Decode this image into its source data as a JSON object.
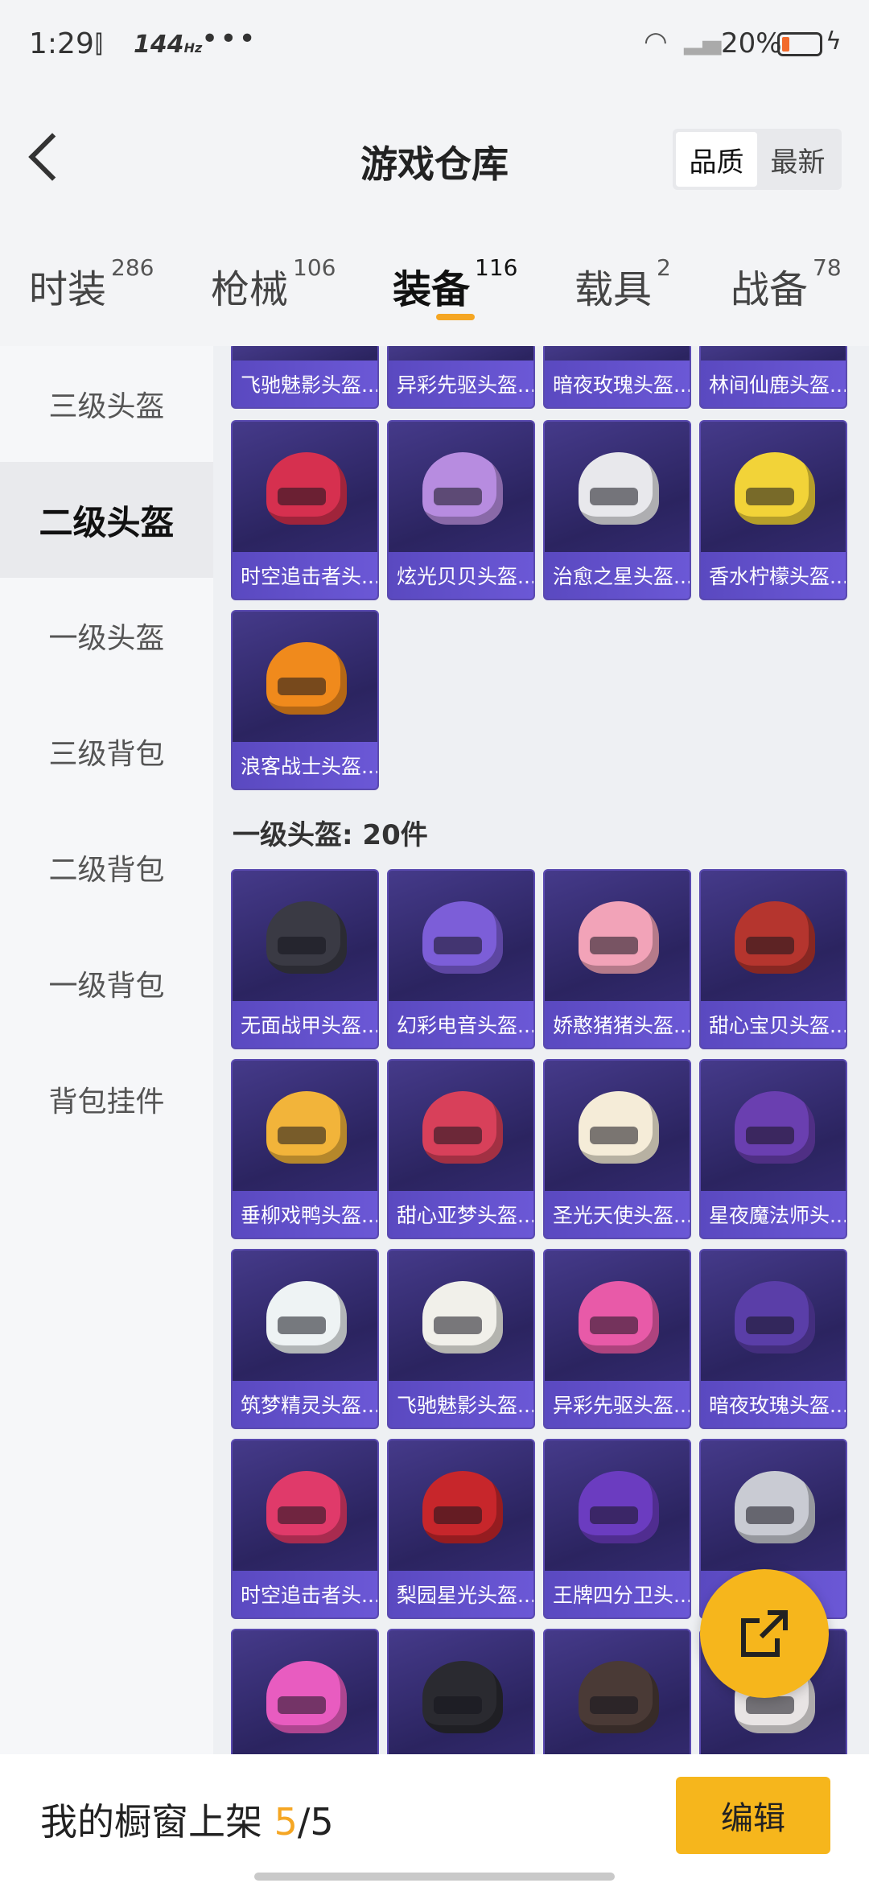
{
  "status": {
    "time": "1:29",
    "refresh": "144",
    "refresh_unit": "Hz",
    "more": "•••",
    "battery": "20%",
    "battery_fraction": 0.2
  },
  "header": {
    "title": "游戏仓库",
    "sort_options": [
      "品质",
      "最新"
    ],
    "sort_active": "品质"
  },
  "tabs": [
    {
      "label": "时装",
      "count": "286"
    },
    {
      "label": "枪械",
      "count": "106"
    },
    {
      "label": "装备",
      "count": "116"
    },
    {
      "label": "载具",
      "count": "2"
    },
    {
      "label": "战备",
      "count": "78"
    }
  ],
  "active_tab": "装备",
  "sidebar": {
    "items": [
      "三级头盔",
      "二级头盔",
      "一级头盔",
      "三级背包",
      "二级背包",
      "一级背包",
      "背包挂件"
    ],
    "active": "二级头盔"
  },
  "partial_row": [
    "飞驰魅影头盔...",
    "异彩先驱头盔...",
    "暗夜玫瑰头盔...",
    "林间仙鹿头盔..."
  ],
  "level2_items": [
    {
      "name": "时空追击者头...",
      "color": "#d6304f"
    },
    {
      "name": "炫光贝贝头盔...",
      "color": "#b78ce0"
    },
    {
      "name": "治愈之星头盔...",
      "color": "#e8e8ec"
    },
    {
      "name": "香水柠檬头盔...",
      "color": "#f2d338"
    },
    {
      "name": "浪客战士头盔...",
      "color": "#f08a1c"
    }
  ],
  "section_level1": "一级头盔: 20件",
  "level1_items": [
    {
      "name": "无面战甲头盔...",
      "color": "#3a3a44"
    },
    {
      "name": "幻彩电音头盔...",
      "color": "#7c5ed8"
    },
    {
      "name": "娇憨猪猪头盔...",
      "color": "#f2a3b8"
    },
    {
      "name": "甜心宝贝头盔...",
      "color": "#b5352e"
    },
    {
      "name": "垂柳戏鸭头盔...",
      "color": "#f2b43a"
    },
    {
      "name": "甜心亚梦头盔...",
      "color": "#d8405a"
    },
    {
      "name": "圣光天使头盔...",
      "color": "#f5ecd8"
    },
    {
      "name": "星夜魔法师头...",
      "color": "#6a3fb0"
    },
    {
      "name": "筑梦精灵头盔...",
      "color": "#eef3f4"
    },
    {
      "name": "飞驰魅影头盔...",
      "color": "#f1f0ea"
    },
    {
      "name": "异彩先驱头盔...",
      "color": "#e85aa8"
    },
    {
      "name": "暗夜玫瑰头盔...",
      "color": "#5a3ea8"
    },
    {
      "name": "时空追击者头...",
      "color": "#e03a6a"
    },
    {
      "name": "梨园星光头盔...",
      "color": "#c7262b"
    },
    {
      "name": "王牌四分卫头...",
      "color": "#6b3cc0"
    },
    {
      "name": "",
      "color": "#c9cbd3"
    },
    {
      "name": "",
      "color": "#e85cc0"
    },
    {
      "name": "",
      "color": "#2a2a30"
    },
    {
      "name": "",
      "color": "#4a3a36"
    },
    {
      "name": "",
      "color": "#e8e4e4"
    }
  ],
  "bottom": {
    "label": "我的橱窗上架",
    "current": "5",
    "total": "/5",
    "edit": "编辑"
  },
  "icons": {
    "back": "chevron-left-icon",
    "share": "share-external-icon"
  }
}
